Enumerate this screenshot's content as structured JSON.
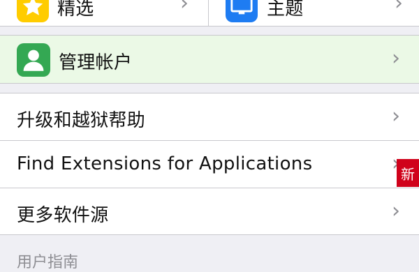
{
  "top_row": {
    "left_label": "精选",
    "right_label": "主题",
    "left_icon": "star-icon",
    "right_icon": "monitor-icon",
    "left_icon_color": "#ffcc00",
    "right_icon_color": "#1e7cf2"
  },
  "account_row": {
    "label": "管理帐户",
    "icon": "user-icon",
    "icon_color": "#34a853",
    "background": "#ebf9e6"
  },
  "menu_items": [
    {
      "label": "升级和越狱帮助"
    },
    {
      "label": "Find Extensions for Applications"
    },
    {
      "label": "更多软件源"
    }
  ],
  "new_badge": {
    "label": "新",
    "color": "#d0021b"
  },
  "section_header": {
    "label": "用户指南"
  }
}
